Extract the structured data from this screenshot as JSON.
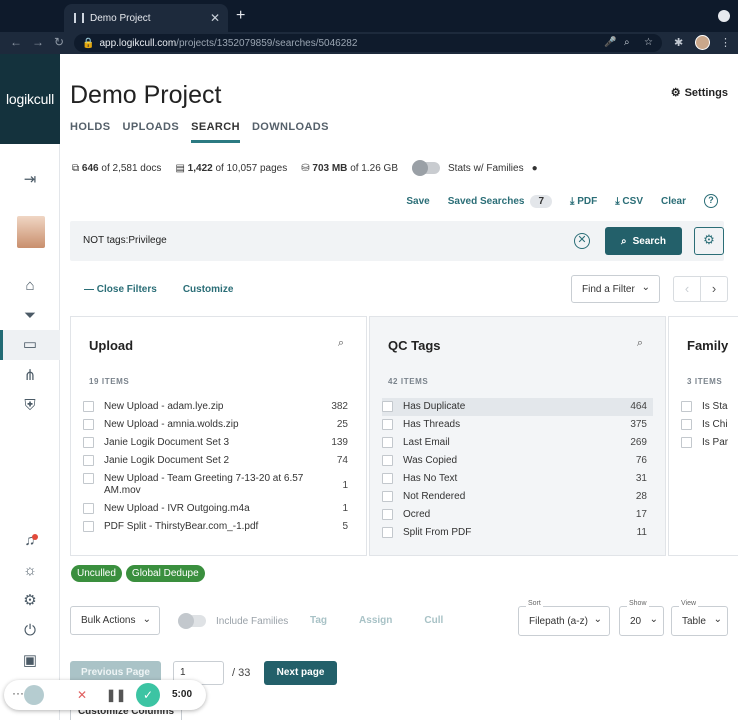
{
  "browser": {
    "tab_title": "Demo Project",
    "tab_close": "✕",
    "new_tab": "+",
    "url_host": "app.logikcull.com",
    "url_path": "/projects/1352079859/searches/5046282"
  },
  "sidebar": {
    "logo": "logikcull",
    "icons": [
      "collapse-icon",
      "home-icon",
      "filter-funnel-icon",
      "search-book-icon",
      "share-icon",
      "shield-icon",
      "bell-icon",
      "sun-icon",
      "gear-icon",
      "power-icon",
      "user-badge-icon"
    ]
  },
  "header": {
    "project_title": "Demo Project",
    "settings_label": "Settings",
    "tabs": [
      {
        "label": "HOLDS"
      },
      {
        "label": "UPLOADS"
      },
      {
        "label": "SEARCH"
      },
      {
        "label": "DOWNLOADS"
      }
    ]
  },
  "stats": {
    "docs_count": "646",
    "docs_total": "of 2,581 docs",
    "pages_count": "1,422",
    "pages_total": "of 10,057 pages",
    "size_count": "703 MB",
    "size_total": "of 1.26 GB",
    "families_label": "Stats w/ Families",
    "families_on": false
  },
  "toolbar": {
    "save": "Save",
    "saved_searches": "Saved Searches",
    "saved_count": "7",
    "pdf": "PDF",
    "csv": "CSV",
    "clear": "Clear",
    "help": "?"
  },
  "search": {
    "query": "NOT tags:Privilege",
    "clear_icon": "✕",
    "button": "Search"
  },
  "filters": {
    "close_filters": "— Close Filters",
    "customize": "Customize",
    "find_filter": "Find a Filter",
    "prev": "‹",
    "next": "›"
  },
  "panels": {
    "upload": {
      "title": "Upload",
      "count": "19 ITEMS",
      "items": [
        {
          "label": "New Upload - adam.lye.zip",
          "n": "382"
        },
        {
          "label": "New Upload - amnia.wolds.zip",
          "n": "25"
        },
        {
          "label": "Janie Logik Document Set 3",
          "n": "139"
        },
        {
          "label": "Janie Logik Document Set 2",
          "n": "74"
        },
        {
          "label": "New Upload - Team Greeting 7-13-20 at 6.57 AM.mov",
          "n": "1"
        },
        {
          "label": "New Upload - IVR Outgoing.m4a",
          "n": "1"
        },
        {
          "label": "PDF Split - ThirstyBear.com_-1.pdf",
          "n": "5"
        }
      ]
    },
    "qc": {
      "title": "QC Tags",
      "count": "42 ITEMS",
      "items": [
        {
          "label": "Has Duplicate",
          "n": "464"
        },
        {
          "label": "Has Threads",
          "n": "375"
        },
        {
          "label": "Last Email",
          "n": "269"
        },
        {
          "label": "Was Copied",
          "n": "76"
        },
        {
          "label": "Has No Text",
          "n": "31"
        },
        {
          "label": "Not Rendered",
          "n": "28"
        },
        {
          "label": "Ocred",
          "n": "17"
        },
        {
          "label": "Split From PDF",
          "n": "11"
        }
      ]
    },
    "family": {
      "title": "Family",
      "count": "3 ITEMS",
      "items": [
        {
          "label": "Is Sta"
        },
        {
          "label": "Is Chi"
        },
        {
          "label": "Is Par"
        }
      ]
    }
  },
  "active_tags": [
    "Unculled",
    "Global Dedupe"
  ],
  "actions": {
    "bulk": "Bulk Actions",
    "include_families": "Include Families",
    "tag": "Tag",
    "assign": "Assign",
    "cull": "Cull",
    "sort_label": "Sort",
    "sort_value": "Filepath (a-z)",
    "show_label": "Show",
    "show_value": "20",
    "view_label": "View",
    "view_value": "Table"
  },
  "pagination": {
    "prev": "Previous Page",
    "page": "1",
    "of": "/ 33",
    "next": "Next page",
    "customize_columns": "Customize Columns"
  },
  "recorder": {
    "more": "···",
    "time": "5:00"
  },
  "colors": {
    "accent": "#23606a",
    "link": "#2b6e77",
    "tag_green": "#3a8f3e",
    "brand_dark": "#14323d"
  }
}
